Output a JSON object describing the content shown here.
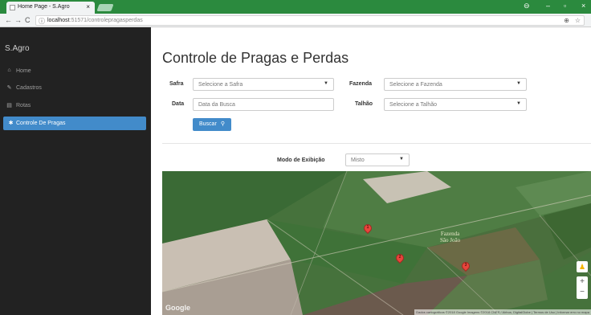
{
  "browser": {
    "tab_title": "Home Page - S.Agro",
    "tab_close": "×",
    "nav_back": "←",
    "nav_forward": "→",
    "nav_reload": "C",
    "info_icon": "ⓘ",
    "url_host": "localhost",
    "url_path": ":51571/controlepragasperdas",
    "zoom_icon": "⊕",
    "star_icon": "☆",
    "account_icon": "⊖",
    "minimize": "–",
    "maximize": "▫",
    "close": "×"
  },
  "sidebar": {
    "brand": "S.Agro",
    "items": [
      {
        "label": "Home",
        "icon": "home-icon",
        "glyph": "⌂"
      },
      {
        "label": "Cadastros",
        "icon": "pencil-icon",
        "glyph": "✎"
      },
      {
        "label": "Rotas",
        "icon": "map-icon",
        "glyph": "▤"
      },
      {
        "label": "Controle De Pragas",
        "icon": "bug-icon",
        "glyph": "✱"
      }
    ]
  },
  "main": {
    "title": "Controle de Pragas e Perdas",
    "safra_label": "Safra",
    "safra_value": "Selecione a Safra",
    "fazenda_label": "Fazenda",
    "fazenda_value": "Selecione a Fazenda",
    "data_label": "Data",
    "data_placeholder": "Data da Busca",
    "talhao_label": "Talhão",
    "talhao_value": "Selecione a Talhão",
    "search_button": "Buscar",
    "search_glyph": "⚲",
    "caret": "▼",
    "mode_label": "Modo de Exibição",
    "mode_value": "Misto"
  },
  "map": {
    "farm_label_line1": "Fazenda",
    "farm_label_line2": "São João",
    "google_logo": "Google",
    "attribution": "Dados cartográficos ©2018 Google Imagens ©2018 CNES / Airbus, DigitalGlobe | Termos de Uso | Informar erro no mapa",
    "markers": [
      "1",
      "2",
      "3"
    ],
    "zoom_in": "+",
    "zoom_out": "−",
    "pegman_glyph": "♟"
  }
}
